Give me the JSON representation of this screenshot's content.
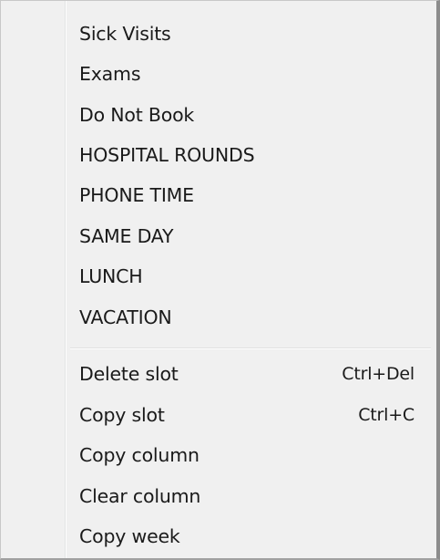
{
  "menu": {
    "appointment_types": [
      {
        "label": "Sick Visits"
      },
      {
        "label": "Exams"
      },
      {
        "label": "Do Not Book"
      },
      {
        "label": "HOSPITAL ROUNDS"
      },
      {
        "label": "PHONE TIME"
      },
      {
        "label": "SAME DAY"
      },
      {
        "label": "LUNCH"
      },
      {
        "label": "VACATION"
      }
    ],
    "actions": [
      {
        "label": "Delete slot",
        "shortcut": "Ctrl+Del"
      },
      {
        "label": "Copy slot",
        "shortcut": "Ctrl+C"
      },
      {
        "label": "Copy column",
        "shortcut": ""
      },
      {
        "label": "Clear column",
        "shortcut": ""
      },
      {
        "label": "Copy week",
        "shortcut": ""
      }
    ]
  }
}
